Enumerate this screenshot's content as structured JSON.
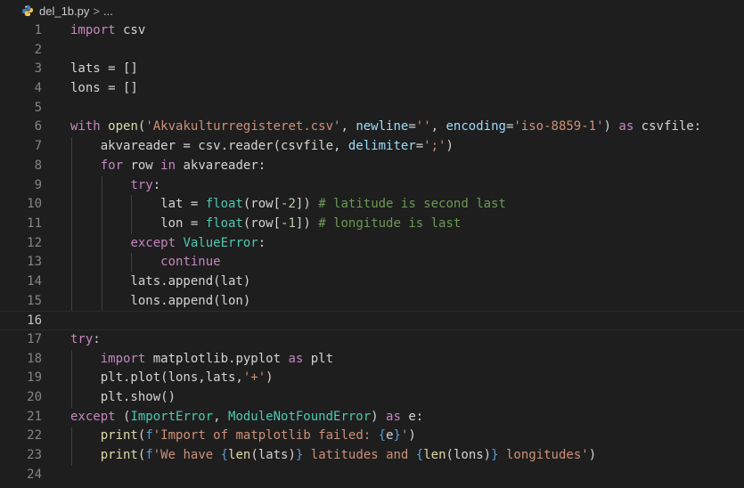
{
  "breadcrumb": {
    "file": "del_1b.py",
    "separator": ">",
    "more": "..."
  },
  "code_lines": [
    [
      [
        "kw",
        "import"
      ],
      [
        "df",
        " csv"
      ]
    ],
    [],
    [
      [
        "df",
        "lats = []"
      ]
    ],
    [
      [
        "df",
        "lons = []"
      ]
    ],
    [],
    [
      [
        "kw",
        "with"
      ],
      [
        "df",
        " "
      ],
      [
        "fn",
        "open"
      ],
      [
        "df",
        "("
      ],
      [
        "str",
        "'Akvakulturregisteret.csv'"
      ],
      [
        "df",
        ", "
      ],
      [
        "pm",
        "newline"
      ],
      [
        "df",
        "="
      ],
      [
        "str",
        "''"
      ],
      [
        "df",
        ", "
      ],
      [
        "pm",
        "encoding"
      ],
      [
        "df",
        "="
      ],
      [
        "str",
        "'iso-8859-1'"
      ],
      [
        "df",
        ") "
      ],
      [
        "kw",
        "as"
      ],
      [
        "df",
        " csvfile:"
      ]
    ],
    [
      [
        "df",
        "    akvareader = csv.reader(csvfile, "
      ],
      [
        "pm",
        "delimiter"
      ],
      [
        "df",
        "="
      ],
      [
        "str",
        "';'"
      ],
      [
        "df",
        ")"
      ]
    ],
    [
      [
        "df",
        "    "
      ],
      [
        "kw",
        "for"
      ],
      [
        "df",
        " row "
      ],
      [
        "kw",
        "in"
      ],
      [
        "df",
        " akvareader:"
      ]
    ],
    [
      [
        "df",
        "        "
      ],
      [
        "kw",
        "try"
      ],
      [
        "df",
        ":"
      ]
    ],
    [
      [
        "df",
        "            lat = "
      ],
      [
        "bi",
        "float"
      ],
      [
        "df",
        "(row["
      ],
      [
        "num",
        "-2"
      ],
      [
        "df",
        "]) "
      ],
      [
        "cm",
        "# latitude is second last"
      ]
    ],
    [
      [
        "df",
        "            lon = "
      ],
      [
        "bi",
        "float"
      ],
      [
        "df",
        "(row["
      ],
      [
        "num",
        "-1"
      ],
      [
        "df",
        "]) "
      ],
      [
        "cm",
        "# longitude is last"
      ]
    ],
    [
      [
        "df",
        "        "
      ],
      [
        "kw",
        "except"
      ],
      [
        "df",
        " "
      ],
      [
        "bi",
        "ValueError"
      ],
      [
        "df",
        ":"
      ]
    ],
    [
      [
        "df",
        "            "
      ],
      [
        "kw",
        "continue"
      ]
    ],
    [
      [
        "df",
        "        lats.append(lat)"
      ]
    ],
    [
      [
        "df",
        "        lons.append(lon)"
      ]
    ],
    [],
    [
      [
        "kw",
        "try"
      ],
      [
        "df",
        ":"
      ]
    ],
    [
      [
        "df",
        "    "
      ],
      [
        "kw",
        "import"
      ],
      [
        "df",
        " matplotlib.pyplot "
      ],
      [
        "kw",
        "as"
      ],
      [
        "df",
        " plt"
      ]
    ],
    [
      [
        "df",
        "    plt.plot(lons,lats,"
      ],
      [
        "str",
        "'+'"
      ],
      [
        "df",
        ")"
      ]
    ],
    [
      [
        "df",
        "    plt.show()"
      ]
    ],
    [
      [
        "kw",
        "except"
      ],
      [
        "df",
        " ("
      ],
      [
        "bi",
        "ImportError"
      ],
      [
        "df",
        ", "
      ],
      [
        "bi",
        "ModuleNotFoundError"
      ],
      [
        "df",
        ") "
      ],
      [
        "kw",
        "as"
      ],
      [
        "df",
        " e:"
      ]
    ],
    [
      [
        "df",
        "    "
      ],
      [
        "fn",
        "print"
      ],
      [
        "df",
        "("
      ],
      [
        "bl",
        "f"
      ],
      [
        "str",
        "'Import of matplotlib failed: "
      ],
      [
        "bl",
        "{"
      ],
      [
        "df",
        "e"
      ],
      [
        "bl",
        "}"
      ],
      [
        "str",
        "'"
      ],
      [
        "df",
        ")"
      ]
    ],
    [
      [
        "df",
        "    "
      ],
      [
        "fn",
        "print"
      ],
      [
        "df",
        "("
      ],
      [
        "bl",
        "f"
      ],
      [
        "str",
        "'We have "
      ],
      [
        "bl",
        "{"
      ],
      [
        "fn",
        "len"
      ],
      [
        "df",
        "(lats)"
      ],
      [
        "bl",
        "}"
      ],
      [
        "str",
        " latitudes and "
      ],
      [
        "bl",
        "{"
      ],
      [
        "fn",
        "len"
      ],
      [
        "df",
        "(lons)"
      ],
      [
        "bl",
        "}"
      ],
      [
        "str",
        " longitudes'"
      ],
      [
        "df",
        ")"
      ]
    ],
    []
  ],
  "current_line": 16,
  "colors": {
    "background": "#1e1e1e",
    "keyword": "#c586c0",
    "string": "#ce9178",
    "comment": "#6a9955",
    "builtin": "#4ec9b0"
  }
}
